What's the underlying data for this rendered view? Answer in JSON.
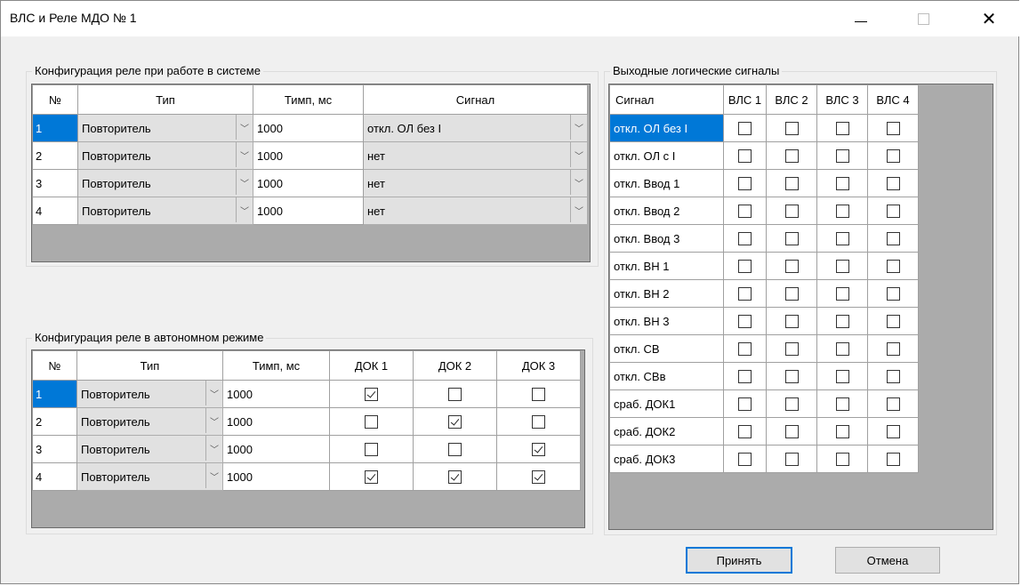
{
  "window": {
    "title": "ВЛС и Реле МДО № 1"
  },
  "system_group": {
    "legend": "Конфигурация реле при работе в системе",
    "headers": {
      "num": "№",
      "type": "Тип",
      "time": "Тимп, мс",
      "signal": "Сигнал"
    },
    "rows": [
      {
        "num": "1",
        "type": "Повторитель",
        "time": "1000",
        "signal": "откл. ОЛ без I"
      },
      {
        "num": "2",
        "type": "Повторитель",
        "time": "1000",
        "signal": "нет"
      },
      {
        "num": "3",
        "type": "Повторитель",
        "time": "1000",
        "signal": "нет"
      },
      {
        "num": "4",
        "type": "Повторитель",
        "time": "1000",
        "signal": "нет"
      }
    ]
  },
  "auto_group": {
    "legend": "Конфигурация реле в автономном режиме",
    "headers": {
      "num": "№",
      "type": "Тип",
      "time": "Тимп, мс",
      "dok1": "ДОК 1",
      "dok2": "ДОК 2",
      "dok3": "ДОК 3"
    },
    "rows": [
      {
        "num": "1",
        "type": "Повторитель",
        "time": "1000",
        "dok": [
          true,
          false,
          false
        ]
      },
      {
        "num": "2",
        "type": "Повторитель",
        "time": "1000",
        "dok": [
          false,
          true,
          false
        ]
      },
      {
        "num": "3",
        "type": "Повторитель",
        "time": "1000",
        "dok": [
          false,
          false,
          true
        ]
      },
      {
        "num": "4",
        "type": "Повторитель",
        "time": "1000",
        "dok": [
          true,
          true,
          true
        ]
      }
    ]
  },
  "output_group": {
    "legend": "Выходные логические сигналы",
    "headers": {
      "signal": "Сигнал",
      "vls1": "ВЛС 1",
      "vls2": "ВЛС 2",
      "vls3": "ВЛС 3",
      "vls4": "ВЛС 4"
    },
    "rows": [
      {
        "label": "откл. ОЛ без I"
      },
      {
        "label": "откл. ОЛ с I"
      },
      {
        "label": "откл. Ввод 1"
      },
      {
        "label": "откл. Ввод 2"
      },
      {
        "label": "откл. Ввод 3"
      },
      {
        "label": "откл. ВН 1"
      },
      {
        "label": "откл. ВН 2"
      },
      {
        "label": "откл. ВН 3"
      },
      {
        "label": "откл. СВ"
      },
      {
        "label": "откл. СВв"
      },
      {
        "label": "сраб. ДОК1"
      },
      {
        "label": "сраб. ДОК2"
      },
      {
        "label": "сраб. ДОК3"
      }
    ]
  },
  "buttons": {
    "accept": "Принять",
    "cancel": "Отмена"
  },
  "colors": {
    "selection": "#0078d7",
    "window_bg": "#f0f0f0",
    "combo_bg": "#e1e1e1"
  }
}
